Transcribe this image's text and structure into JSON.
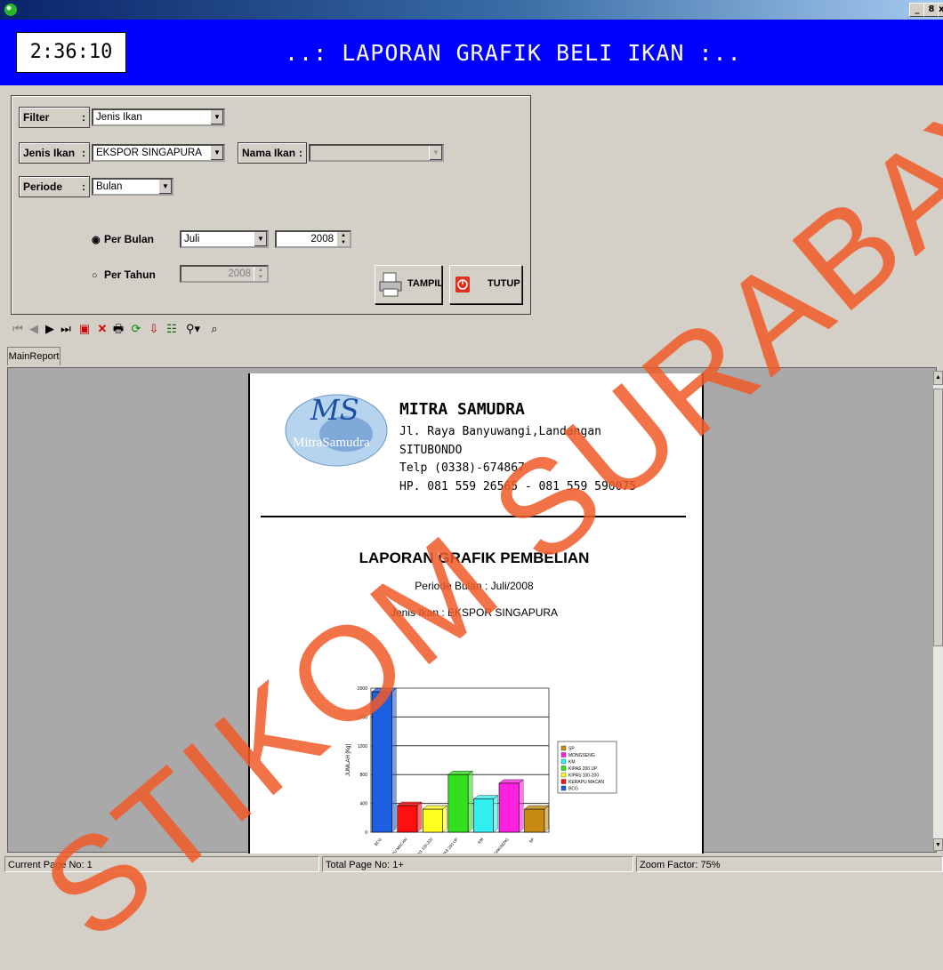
{
  "window": {
    "minimize": "_",
    "restore": "8",
    "close": "x"
  },
  "header": {
    "clock": "2:36:10",
    "title": "..: LAPORAN GRAFIK BELI IKAN :.."
  },
  "filter": {
    "filter_label": "Filter",
    "filter_value": "Jenis Ikan",
    "jenis_label": "Jenis Ikan",
    "jenis_value": "EKSPOR SINGAPURA",
    "nama_label": "Nama Ikan",
    "nama_value": "",
    "periode_label": "Periode",
    "periode_value": "Bulan",
    "per_bulan_label": "Per Bulan",
    "per_bulan_month": "Juli",
    "per_bulan_year": "2008",
    "per_tahun_label": "Per Tahun",
    "per_tahun_year": "2008",
    "tampil_label": "TAMPIL",
    "tutup_label": "TUTUP",
    "colon": ":"
  },
  "tab": {
    "label": "MainReport"
  },
  "report": {
    "logo_text": "MitraSamudra",
    "logo_ms": "MS",
    "company": "MITRA SAMUDRA",
    "address1": "Jl. Raya Banyuwangi,Landangan",
    "address2": "SITUBONDO",
    "phone": "Telp (0338)-674867",
    "hp": "HP. 081 559 26565 - 081 559 590075",
    "title": "LAPORAN GRAFIK PEMBELIAN",
    "periode": "Periode Bulan : Juli/2008",
    "jenis": "Jenis Ikan : EKSPOR SINGAPURA"
  },
  "chart_data": {
    "type": "bar",
    "ylabel": "JUMLAH [Kg]",
    "ylim": [
      0,
      2000
    ],
    "yticks": [
      "0",
      "400",
      "800",
      "1200",
      "1600",
      "2000"
    ],
    "categories": [
      "BCG",
      "KERAPU MACAN",
      "KIPAS 100-200",
      "KIPAS 200 UP",
      "KM",
      "MONGSENG",
      "SP"
    ],
    "values": [
      1950,
      370,
      320,
      800,
      460,
      680,
      320
    ],
    "colors": [
      "#1c5fe0",
      "#ff1010",
      "#ffff20",
      "#33e020",
      "#30f0f0",
      "#ff20e0",
      "#c88a10"
    ],
    "legend": [
      "SP",
      "MONGSENG",
      "KM",
      "KIPAS 200 UP",
      "KIPAS 100-200",
      "KERAPU MACAN",
      "BCG"
    ],
    "legend_colors": [
      "#c88a10",
      "#ff20e0",
      "#30f0f0",
      "#33e020",
      "#ffff20",
      "#ff1010",
      "#1c5fe0"
    ],
    "legend_position": "right",
    "grid": true
  },
  "status": {
    "page": "Current Page No: 1",
    "total": "Total Page No: 1+",
    "zoom": "Zoom Factor: 75%"
  },
  "watermark": "STIKOM SURABAYA"
}
